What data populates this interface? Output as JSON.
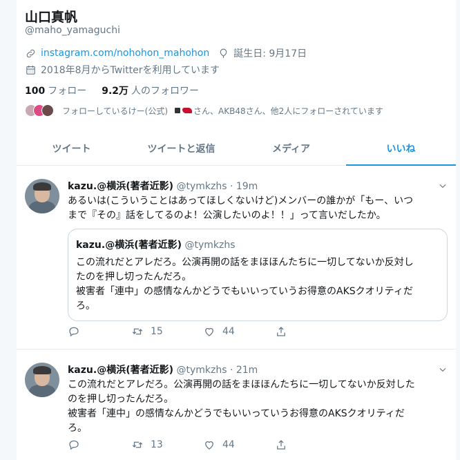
{
  "profile": {
    "name": "山口真帆",
    "handle": "@maho_yamaguchi",
    "link": "instagram.com/nohohon_mahohon",
    "birthday": "誕生日: 9月17日",
    "joined": "2018年8月からTwitterを利用しています",
    "following_count": "100",
    "following_label": "フォロー",
    "followers_count": "9.2万",
    "followers_label": "人のフォロワー",
    "followed_by_a": "フォローしているけー(公式)",
    "followed_by_b": "さん、AKB48さん、他2人にフォローされています"
  },
  "tabs": [
    "ツイート",
    "ツイートと返信",
    "メディア",
    "いいね"
  ],
  "active_tab": "いいね",
  "tweets": [
    {
      "name": "kazu.@横浜(著者近影)",
      "handle": "@tymkzhs",
      "time": "· 19m",
      "text_lines": [
        "あるいは(こういうことはあってほしくないけど)メンバーの誰かが「もー、いつ",
        "まで『その』話をしてるのよ！公演したいのよ！！」って言いだしたか。"
      ],
      "quote": {
        "name": "kazu.@横浜(著者近影)",
        "handle": "@tymkzhs",
        "text_lines": [
          "この流れだとアレだろ。公演再開の話をまほほんたちに一切してないか反対し",
          "たのを押し切ったんだろ。",
          "被害者「連中」の感情なんかどうでもいいっていうお得意のAKSクオリティだ",
          "ろ。"
        ]
      },
      "retweets": "15",
      "likes": "44"
    },
    {
      "name": "kazu.@横浜(著者近影)",
      "handle": "@tymkzhs",
      "time": "· 21m",
      "text_lines": [
        "この流れだとアレだろ。公演再開の話をまほほんたちに一切してないか反対した",
        "のを押し切ったんだろ。",
        "被害者「連中」の感情なんかどうでもいいっていうお得意のAKSクオリティだ",
        "ろ。"
      ],
      "retweets": "13",
      "likes": "44"
    }
  ],
  "colors": {
    "accent": "#1b95e0",
    "muted": "#657786",
    "border": "#e6ecf0"
  }
}
